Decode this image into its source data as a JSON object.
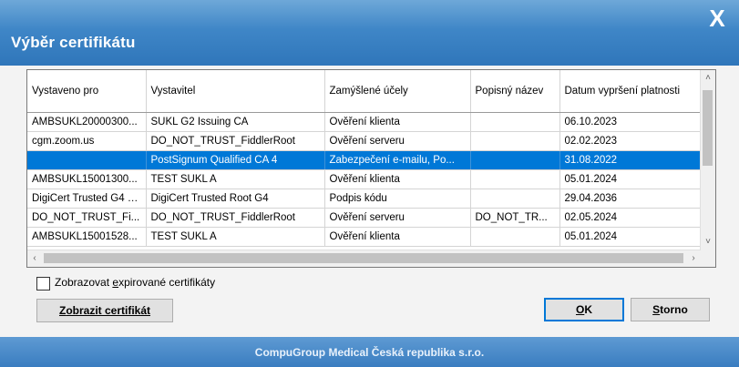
{
  "dialog": {
    "title": "Výběr certifikátu",
    "close_glyph": "X",
    "footer": "CompuGroup Medical Česká republika s.r.o."
  },
  "table": {
    "columns": [
      "Vystaveno pro",
      "Vystavitel",
      "Zamýšlené účely",
      "Popisný název",
      "Datum vypršení platnosti"
    ],
    "rows": [
      [
        "AMBSUKL20000300...",
        "SUKL G2 Issuing CA",
        "Ověření klienta",
        "",
        "06.10.2023"
      ],
      [
        "cgm.zoom.us",
        "DO_NOT_TRUST_FiddlerRoot",
        "Ověření serveru",
        "",
        "02.02.2023"
      ],
      [
        "",
        "PostSignum Qualified CA 4",
        "Zabezpečení e-mailu, Po...",
        "",
        "31.08.2022"
      ],
      [
        "AMBSUKL15001300...",
        "TEST SUKL A",
        "Ověření klienta",
        "",
        "05.01.2024"
      ],
      [
        "DigiCert Trusted G4 C...",
        "DigiCert Trusted Root G4",
        "Podpis kódu",
        "",
        "29.04.2036"
      ],
      [
        "DO_NOT_TRUST_Fi...",
        "DO_NOT_TRUST_FiddlerRoot",
        "Ověření serveru",
        "DO_NOT_TR...",
        "02.05.2024"
      ],
      [
        "AMBSUKL15001528...",
        "TEST SUKL A",
        "Ověření klienta",
        "",
        "05.01.2024"
      ]
    ],
    "selected_row": 2
  },
  "options": {
    "show_expired_label_pre": "Zobrazovat ",
    "show_expired_label_key": "e",
    "show_expired_label_post": "xpirované certifikáty",
    "show_expired_checked": false
  },
  "buttons": {
    "show_cert_key": "Z",
    "show_cert_rest": "obrazit certifikát",
    "ok_key": "O",
    "ok_rest": "K",
    "cancel_key": "S",
    "cancel_rest": "torno"
  },
  "icons": {
    "close": "close-icon",
    "scroll_up": "chevron-up-icon",
    "scroll_down": "chevron-down-icon",
    "scroll_left": "chevron-left-icon",
    "scroll_right": "chevron-right-icon"
  },
  "colors": {
    "titlebar": "#3f86c7",
    "selection": "#0078d7",
    "footer": "#3a7dc0"
  }
}
